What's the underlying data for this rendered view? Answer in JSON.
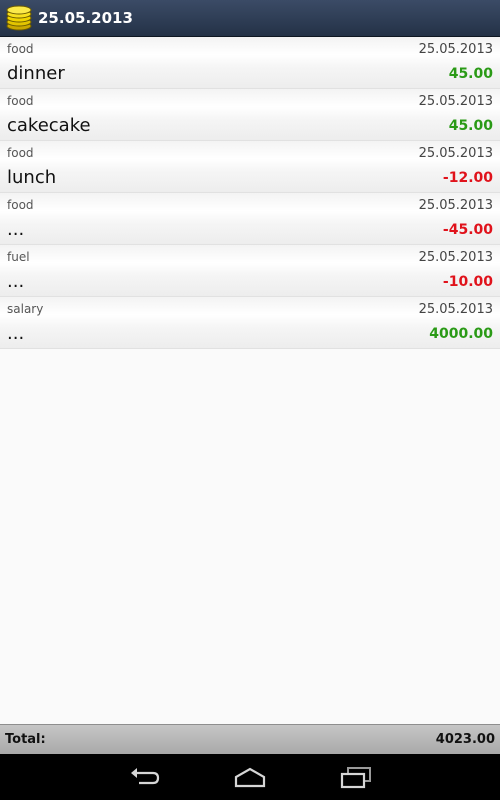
{
  "header": {
    "title": "25.05.2013",
    "icon": "coin-stack-icon"
  },
  "transactions": [
    {
      "category": "food",
      "date": "25.05.2013",
      "name": "dinner",
      "amount": "45.00",
      "sign": "positive"
    },
    {
      "category": "food",
      "date": "25.05.2013",
      "name": "cakecake",
      "amount": "45.00",
      "sign": "positive"
    },
    {
      "category": "food",
      "date": "25.05.2013",
      "name": "lunch",
      "amount": "-12.00",
      "sign": "negative"
    },
    {
      "category": "food",
      "date": "25.05.2013",
      "name": "...",
      "amount": "-45.00",
      "sign": "negative"
    },
    {
      "category": "fuel",
      "date": "25.05.2013",
      "name": "...",
      "amount": "-10.00",
      "sign": "negative"
    },
    {
      "category": "salary",
      "date": "25.05.2013",
      "name": "...",
      "amount": "4000.00",
      "sign": "positive"
    }
  ],
  "footer": {
    "total_label": "Total:",
    "total_value": "4023.00"
  },
  "navigation": {
    "back": "back-icon",
    "home": "home-icon",
    "recents": "recent-apps-icon"
  },
  "colors": {
    "positive": "#2a9a16",
    "negative": "#e0121b",
    "actionbar": "#2f3e56"
  }
}
